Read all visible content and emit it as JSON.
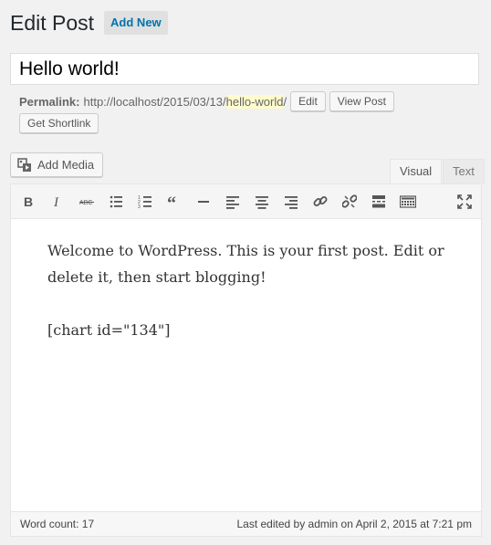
{
  "header": {
    "title": "Edit Post",
    "add_new": "Add New"
  },
  "post": {
    "title": "Hello world!"
  },
  "permalink": {
    "label": "Permalink:",
    "base_url": "http://localhost/2015/03/13/",
    "slug": "hello-world",
    "trailing": "/",
    "edit_label": "Edit",
    "view_label": "View Post",
    "shortlink_label": "Get Shortlink"
  },
  "media": {
    "add_media_label": "Add Media"
  },
  "tabs": {
    "visual": "Visual",
    "text": "Text"
  },
  "toolbar": {
    "icons": [
      "bold-icon",
      "italic-icon",
      "strikethrough-icon",
      "bulleted-list-icon",
      "numbered-list-icon",
      "blockquote-icon",
      "horizontal-rule-icon",
      "align-left-icon",
      "align-center-icon",
      "align-right-icon",
      "link-icon",
      "unlink-icon",
      "read-more-icon",
      "toolbar-toggle-icon",
      "fullscreen-icon"
    ]
  },
  "content": {
    "paragraph1": "Welcome to WordPress. This is your first post. Edit or delete it, then start blogging!",
    "paragraph2": "[chart id=\"134\"]"
  },
  "status": {
    "word_count": "Word count: 17",
    "last_edited": "Last edited by admin on April 2, 2015 at 7:21 pm"
  }
}
